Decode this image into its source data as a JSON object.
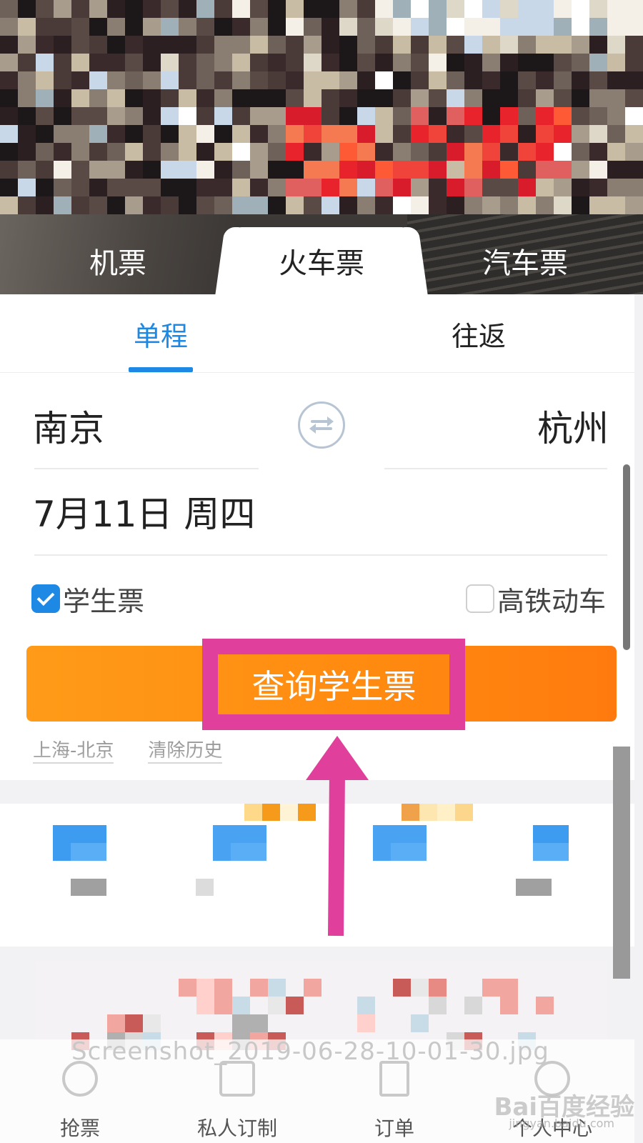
{
  "mode_tabs": {
    "flight": "机票",
    "train": "火车票",
    "bus": "汽车票"
  },
  "trip_tabs": {
    "oneway": "单程",
    "round": "往返"
  },
  "form": {
    "from_city": "南京",
    "to_city": "杭州",
    "date": "7月11日 周四",
    "student_ticket": {
      "label": "学生票",
      "checked": true
    },
    "high_speed": {
      "label": "高铁动车",
      "checked": false
    },
    "search_button": "查询学生票"
  },
  "history": {
    "item": "上海-北京",
    "clear": "清除历史"
  },
  "bottom_nav": [
    "抢票",
    "私人订制",
    "订单",
    "个人中心"
  ],
  "overlay": {
    "filename": "Screenshot_2019-06-28-10-01-30.jpg",
    "watermark": "Bai百度经验",
    "watermark_sub": "jingyan.baidu.com"
  },
  "colors": {
    "accent_blue": "#1e88e5",
    "button_orange": "#ff8a10",
    "annotation_pink": "#e0409b"
  }
}
